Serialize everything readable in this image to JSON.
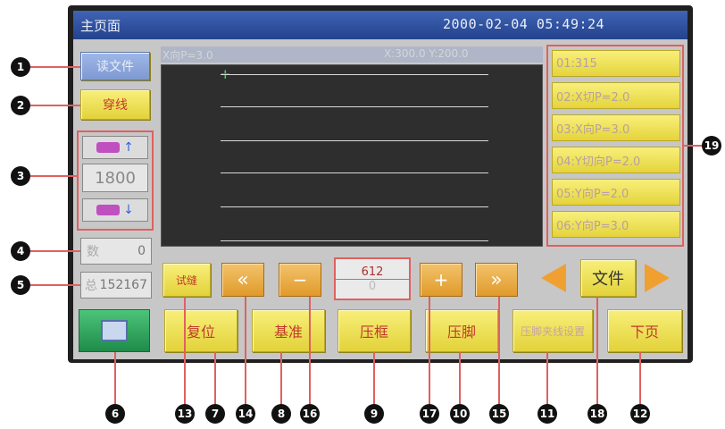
{
  "titlebar": {
    "title": "主页面",
    "clock": "2000-02-04 05:49:24"
  },
  "left": {
    "read_file_label": "读文件",
    "thread_label": "穿线",
    "speed_value": "1800",
    "counter_a": "0",
    "counter_a_prefix": "数",
    "counter_b": "152167",
    "counter_b_prefix": "总"
  },
  "plot": {
    "info_left": "X向P=3.0",
    "info_right": "X:300.0 Y:200.0"
  },
  "params": [
    {
      "label": "01:315"
    },
    {
      "label": "02:X切P=2.0"
    },
    {
      "label": "03:X向P=3.0"
    },
    {
      "label": "04:Y切向P=2.0"
    },
    {
      "label": "05:Y向P=2.0"
    },
    {
      "label": "06:Y向P=3.0"
    }
  ],
  "controls": {
    "trial_label": "试缝",
    "fast_back": "«",
    "step_back": "−",
    "stitch_top": "612",
    "stitch_bottom": "0",
    "step_fwd": "+",
    "fast_fwd": "»",
    "file_label": "文件",
    "reset_label": "复位",
    "origin_label": "基准",
    "frame_label": "压框",
    "foot_label": "压脚",
    "foot_clip_label": "压脚夹线设置",
    "next_page_label": "下页"
  },
  "markers": {
    "m1": "1",
    "m2": "2",
    "m3": "3",
    "m4": "4",
    "m5": "5",
    "m6": "6",
    "m7": "7",
    "m8": "8",
    "m9": "9",
    "m10": "10",
    "m11": "11",
    "m12": "12",
    "m13": "13",
    "m14": "14",
    "m15": "15",
    "m16": "16",
    "m17": "17",
    "m18": "18",
    "m19": "19"
  },
  "colors": {
    "accent_yellow": "#f0e05a",
    "title_blue": "#3159a8",
    "callout_red": "#e06060"
  }
}
